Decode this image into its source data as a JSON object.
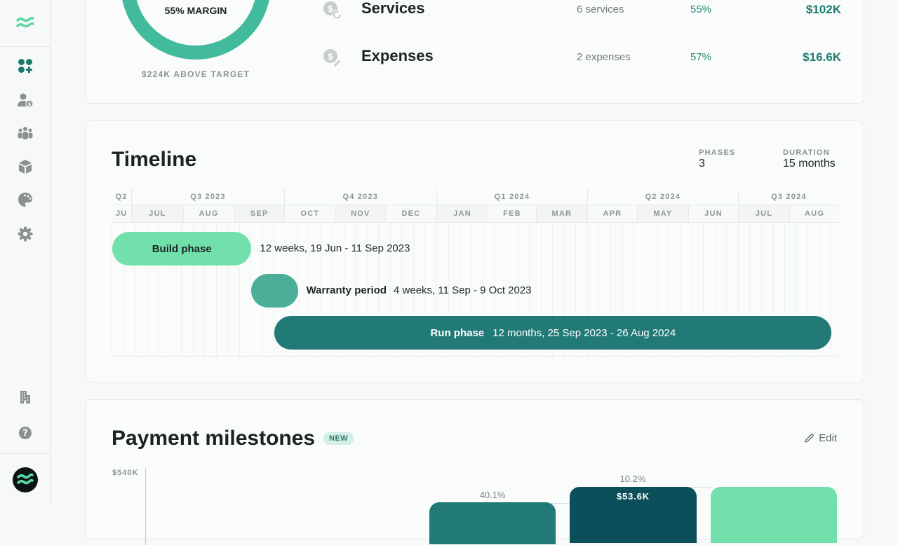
{
  "sidebar": {
    "logo_icon": "wave-logo-icon",
    "items": [
      {
        "name": "dashboard",
        "icon": "apps-add-icon",
        "active": true
      },
      {
        "name": "clients",
        "icon": "user-dollar-icon",
        "active": false
      },
      {
        "name": "team",
        "icon": "team-icon",
        "active": false
      },
      {
        "name": "products",
        "icon": "cube-icon",
        "active": false
      },
      {
        "name": "branding",
        "icon": "palette-icon",
        "active": false
      },
      {
        "name": "settings",
        "icon": "gear-icon",
        "active": false
      }
    ],
    "bottom_items": [
      {
        "name": "company",
        "icon": "building-icon"
      },
      {
        "name": "help",
        "icon": "help-icon"
      }
    ],
    "avatar_icon": "wave-avatar-icon"
  },
  "summary": {
    "margin_label": "55% MARGIN",
    "margin_pct": 55,
    "above_target": "$224K ABOVE TARGET",
    "rows": [
      {
        "name": "Services",
        "icon": "dollar-recurring-icon",
        "count": "6 services",
        "pct": "55%",
        "value": "$102K"
      },
      {
        "name": "Expenses",
        "icon": "dollar-edit-icon",
        "count": "2 expenses",
        "pct": "57%",
        "value": "$16.6K"
      }
    ]
  },
  "timeline": {
    "title": "Timeline",
    "stats": [
      {
        "label": "PHASES",
        "value": "3"
      },
      {
        "label": "DURATION",
        "value": "15 months"
      }
    ],
    "quarters": [
      "Q2",
      "Q3 2023",
      "Q4 2023",
      "Q1 2024",
      "Q2 2024",
      "Q3 2024"
    ],
    "months": [
      "JU",
      "JUL",
      "AUG",
      "SEP",
      "OCT",
      "NOV",
      "DEC",
      "JAN",
      "FEB",
      "MAR",
      "APR",
      "MAY",
      "JUN",
      "JUL",
      "AUG"
    ],
    "phases": [
      {
        "name": "Build phase",
        "detail": "12 weeks, 19 Jun - 11 Sep 2023",
        "color": "#72e0ab",
        "text_color": "#1a2322",
        "start": "2023-06-19",
        "end": "2023-09-11"
      },
      {
        "name": "Warranty period",
        "detail": "4 weeks, 11 Sep - 9 Oct 2023",
        "color": "#4aae98",
        "text_color": "#1a2322",
        "start": "2023-09-11",
        "end": "2023-10-09"
      },
      {
        "name": "Run phase",
        "detail": "12 months, 25 Sep 2023 - 26 Aug 2024",
        "color": "#217a76",
        "text_color": "#ffffff",
        "start": "2023-09-25",
        "end": "2024-08-26"
      }
    ]
  },
  "payments": {
    "title": "Payment milestones",
    "badge": "NEW",
    "edit_label": "Edit",
    "axis_max_label": "$540K",
    "bars": [
      {
        "pct": "40.1%",
        "label": "",
        "color": "#217a76"
      },
      {
        "pct": "10.2%",
        "label": "$53.6K",
        "color": "#0b4f5a"
      },
      {
        "pct": "",
        "label": "",
        "color": "#72e0ab"
      }
    ]
  }
}
